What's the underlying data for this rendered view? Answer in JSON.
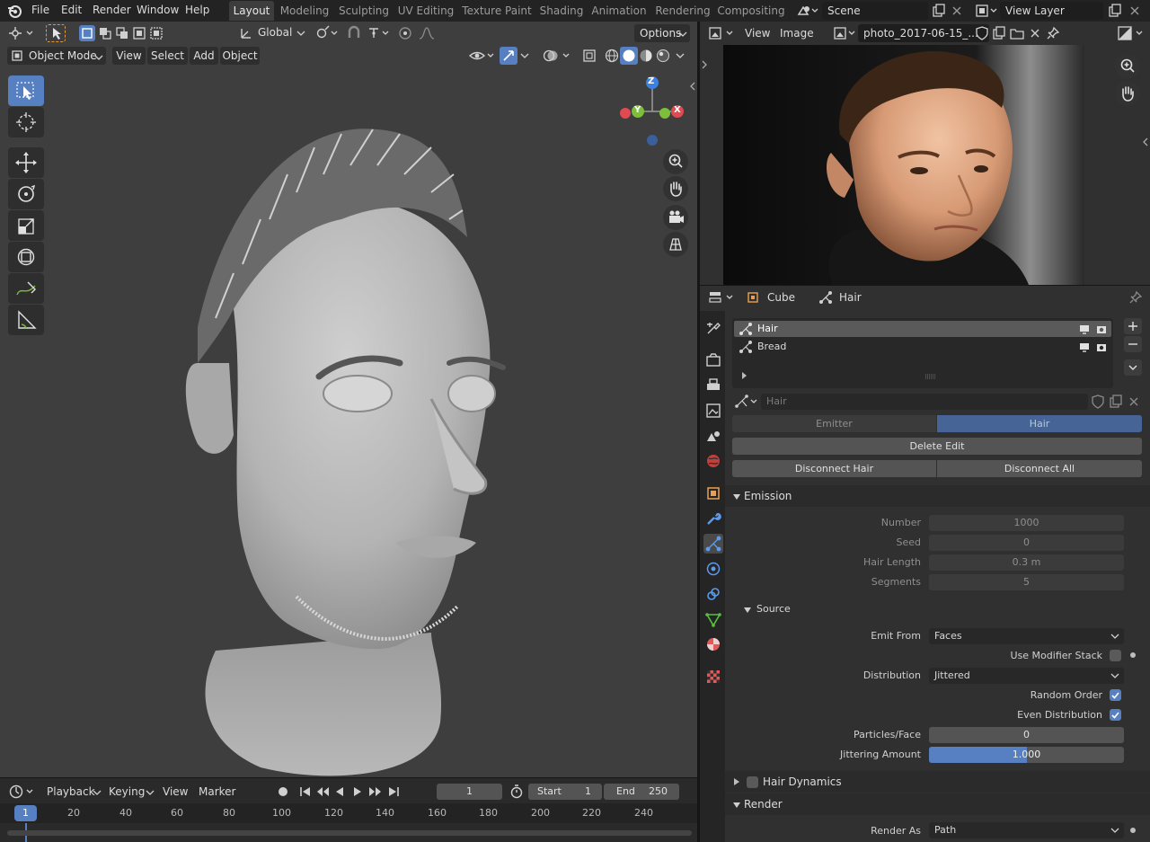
{
  "topbar": {
    "menus": [
      "File",
      "Edit",
      "Render",
      "Window",
      "Help"
    ],
    "workspaces": [
      "Layout",
      "Modeling",
      "Sculpting",
      "UV Editing",
      "Texture Paint",
      "Shading",
      "Animation",
      "Rendering",
      "Compositing"
    ],
    "scene": "Scene",
    "view_layer": "View Layer"
  },
  "viewport": {
    "transform_orientation": "Global",
    "options_label": "Options",
    "mode": "Object Mode",
    "menus": [
      "View",
      "Select",
      "Add",
      "Object"
    ],
    "gizmo": {
      "x": "X",
      "y": "Y",
      "z": "Z"
    }
  },
  "timeline": {
    "menus": [
      "Playback",
      "Keying",
      "View",
      "Marker"
    ],
    "current_frame": "1",
    "start_label": "Start",
    "start": "1",
    "end_label": "End",
    "end": "250",
    "ruler": [
      "20",
      "40",
      "60",
      "80",
      "100",
      "120",
      "140",
      "160",
      "180",
      "200",
      "220",
      "240"
    ],
    "playhead": "1"
  },
  "image_editor": {
    "menus": [
      "View",
      "Image"
    ],
    "image_name": "photo_2017-06-15_..."
  },
  "properties": {
    "breadcrumb_object": "Cube",
    "breadcrumb_item": "Hair",
    "particle_systems": [
      "Hair",
      "Bread"
    ],
    "settings_placeholder": "Hair",
    "type_tabs": [
      "Emitter",
      "Hair"
    ],
    "delete_edit": "Delete Edit",
    "disconnect_hair": "Disconnect Hair",
    "disconnect_all": "Disconnect All",
    "emission": {
      "title": "Emission",
      "number_label": "Number",
      "number": "1000",
      "seed_label": "Seed",
      "seed": "0",
      "hair_length_label": "Hair Length",
      "hair_length": "0.3 m",
      "segments_label": "Segments",
      "segments": "5"
    },
    "source": {
      "title": "Source",
      "emit_from_label": "Emit From",
      "emit_from": "Faces",
      "use_modifier_stack": "Use Modifier Stack",
      "distribution_label": "Distribution",
      "distribution": "Jittered",
      "random_order": "Random Order",
      "even_distribution": "Even Distribution",
      "particles_face_label": "Particles/Face",
      "particles_face": "0",
      "jittering_label": "Jittering Amount",
      "jittering": "1.000",
      "jittering_fill": 1.0
    },
    "hair_dynamics": "Hair Dynamics",
    "render": {
      "title": "Render",
      "render_as_label": "Render As",
      "render_as": "Path"
    }
  },
  "colors": {
    "accent": "#5680c2",
    "axis_x": "#e04a50",
    "axis_y": "#7dbf3a",
    "axis_z": "#3b82e0"
  }
}
